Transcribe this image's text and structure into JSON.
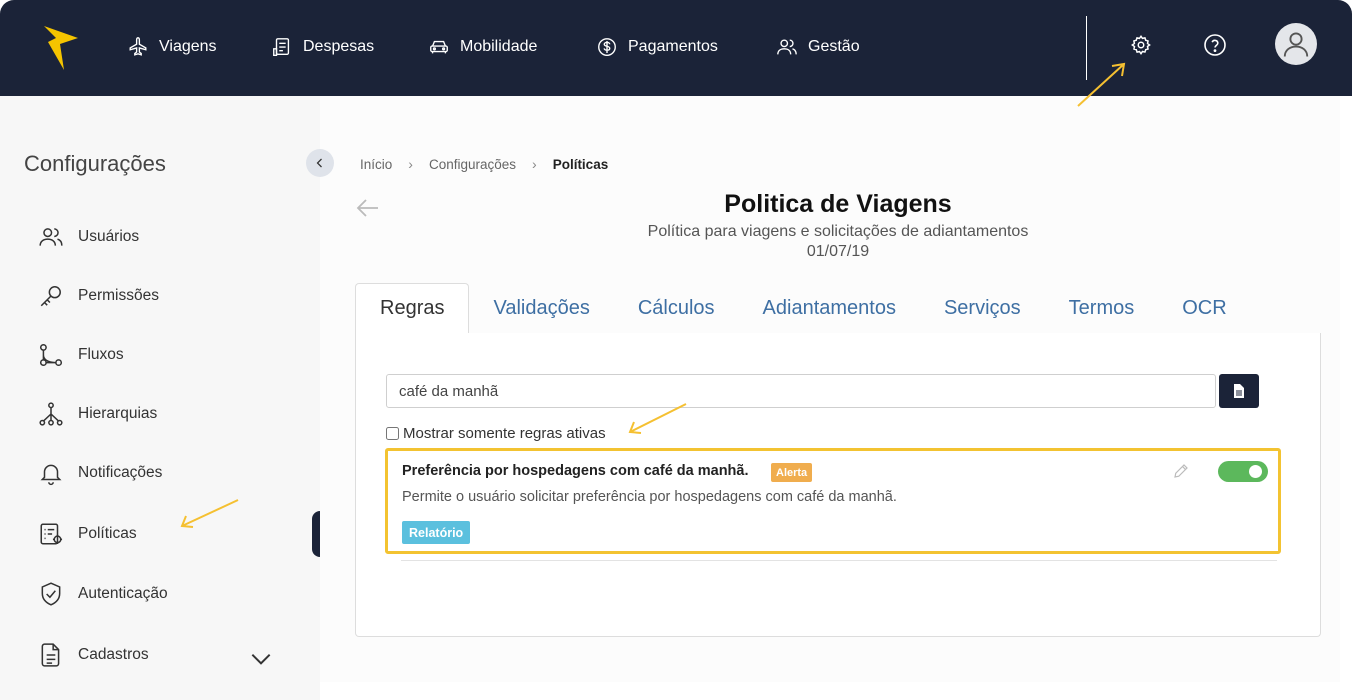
{
  "colors": {
    "nav_bg": "#1b2338",
    "accent_yellow": "#f5c400",
    "tab_link": "#3e6fa3",
    "highlight_border": "#f3c331",
    "toggle_on": "#5cb85c",
    "badge_alert": "#f0ad4e",
    "badge_report": "#5bc0de"
  },
  "topnav": {
    "logo_icon": "bolt-logo-icon",
    "items": [
      {
        "label": "Viagens",
        "icon": "airplane-icon"
      },
      {
        "label": "Despesas",
        "icon": "receipt-icon"
      },
      {
        "label": "Mobilidade",
        "icon": "car-icon"
      },
      {
        "label": "Pagamentos",
        "icon": "dollar-circle-icon"
      },
      {
        "label": "Gestão",
        "icon": "users-icon"
      }
    ],
    "right_icons": [
      "gear-icon",
      "help-circle-icon",
      "user-avatar-icon"
    ]
  },
  "sidebar": {
    "title": "Configurações",
    "items": [
      {
        "label": "Usuários",
        "icon": "users-icon"
      },
      {
        "label": "Permissões",
        "icon": "key-icon"
      },
      {
        "label": "Fluxos",
        "icon": "flow-icon"
      },
      {
        "label": "Hierarquias",
        "icon": "hierarchy-icon"
      },
      {
        "label": "Notificações",
        "icon": "bell-icon"
      },
      {
        "label": "Políticas",
        "icon": "policy-icon",
        "active": true
      },
      {
        "label": "Autenticação",
        "icon": "shield-check-icon"
      },
      {
        "label": "Cadastros",
        "icon": "document-icon",
        "expandable": true
      }
    ]
  },
  "breadcrumb": {
    "items": [
      "Início",
      "Configurações",
      "Políticas"
    ]
  },
  "page": {
    "title": "Politica de Viagens",
    "subtitle": "Política para viagens e solicitações de adiantamentos",
    "date": "01/07/19"
  },
  "tabs": [
    {
      "label": "Regras",
      "active": true
    },
    {
      "label": "Validações"
    },
    {
      "label": "Cálculos"
    },
    {
      "label": "Adiantamentos"
    },
    {
      "label": "Serviços"
    },
    {
      "label": "Termos"
    },
    {
      "label": "OCR"
    }
  ],
  "rules_panel": {
    "search_value": "café da manhã",
    "active_only_label": "Mostrar somente regras ativas",
    "active_only_checked": false,
    "rule": {
      "title": "Preferência por hospedagens com café da manhã.",
      "badge": "Alerta",
      "description": "Permite o usuário solicitar preferência por hospedagens com café da manhã.",
      "tag": "Relatório",
      "enabled": true
    }
  }
}
